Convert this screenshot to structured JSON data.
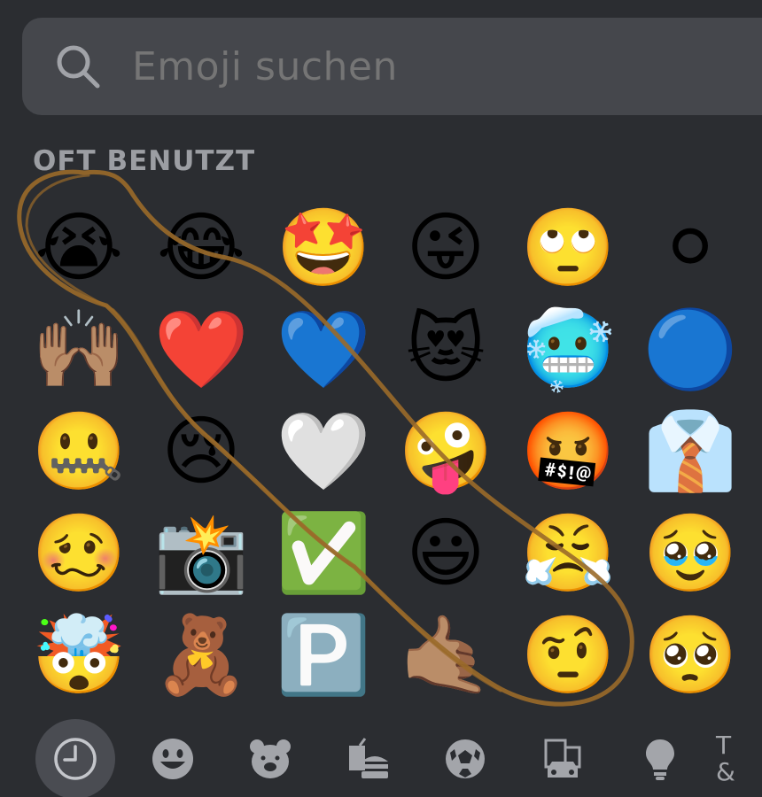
{
  "search": {
    "placeholder": "Emoji suchen",
    "icon": "search-icon"
  },
  "section": {
    "title": "OFT BENUTZT"
  },
  "emojis": [
    {
      "char": "😭",
      "name": "loudly-crying-face"
    },
    {
      "char": "😂",
      "name": "face-with-tears-of-joy"
    },
    {
      "char": "🤩",
      "name": "star-struck"
    },
    {
      "char": "😜",
      "name": "winking-face-with-tongue"
    },
    {
      "char": "🙄",
      "name": "face-with-rolling-eyes"
    },
    {
      "char": "⚪",
      "name": "white-circle"
    },
    {
      "char": "🙌🏽",
      "name": "raising-hands"
    },
    {
      "char": "❤️",
      "name": "red-heart"
    },
    {
      "char": "💙",
      "name": "blue-heart"
    },
    {
      "char": "😻",
      "name": "smiling-cat-with-heart-eyes"
    },
    {
      "char": "🥶",
      "name": "cold-face"
    },
    {
      "char": "🔵",
      "name": "blue-circle"
    },
    {
      "char": "🤐",
      "name": "zipper-mouth-face"
    },
    {
      "char": "😢",
      "name": "crying-face"
    },
    {
      "char": "🤍",
      "name": "white-heart"
    },
    {
      "char": "🤪",
      "name": "zany-face"
    },
    {
      "char": "🤬",
      "name": "face-with-symbols-on-mouth"
    },
    {
      "char": "👔",
      "name": "necktie"
    },
    {
      "char": "🥴",
      "name": "woozy-face"
    },
    {
      "char": "📸",
      "name": "camera-with-flash"
    },
    {
      "char": "✅",
      "name": "check-mark-button"
    },
    {
      "char": "😃",
      "name": "grinning-face-with-big-eyes"
    },
    {
      "char": "😤",
      "name": "face-with-steam-from-nose"
    },
    {
      "char": "🥹",
      "name": "face-holding-back-tears"
    },
    {
      "char": "🤯",
      "name": "exploding-head"
    },
    {
      "char": "🧸",
      "name": "teddy-bear"
    },
    {
      "char": "🅿️",
      "name": "p-button"
    },
    {
      "char": "🤙🏽",
      "name": "call-me-hand"
    },
    {
      "char": "🤨",
      "name": "face-with-raised-eyebrow"
    },
    {
      "char": "🥺",
      "name": "pleading-face"
    }
  ],
  "categories": [
    {
      "icon": "clock-icon",
      "label": "Oft benutzt",
      "active": true
    },
    {
      "icon": "smiley-icon",
      "label": "Smileys & Personen",
      "active": false
    },
    {
      "icon": "bear-icon",
      "label": "Tiere & Natur",
      "active": false
    },
    {
      "icon": "food-icon",
      "label": "Essen & Trinken",
      "active": false
    },
    {
      "icon": "soccer-ball-icon",
      "label": "Aktivität",
      "active": false
    },
    {
      "icon": "car-building-icon",
      "label": "Reisen & Orte",
      "active": false
    },
    {
      "icon": "lightbulb-icon",
      "label": "Objekte",
      "active": false
    },
    {
      "icon": "symbols-icon",
      "label": "Symbole",
      "active": false
    }
  ],
  "symbols_glyph": {
    "line1": "T",
    "line2": "&"
  },
  "colors": {
    "background": "#2b2d31",
    "search_background": "#45474c",
    "text_muted": "#9c9ea3",
    "annotation_stroke": "#9a6a2a"
  }
}
